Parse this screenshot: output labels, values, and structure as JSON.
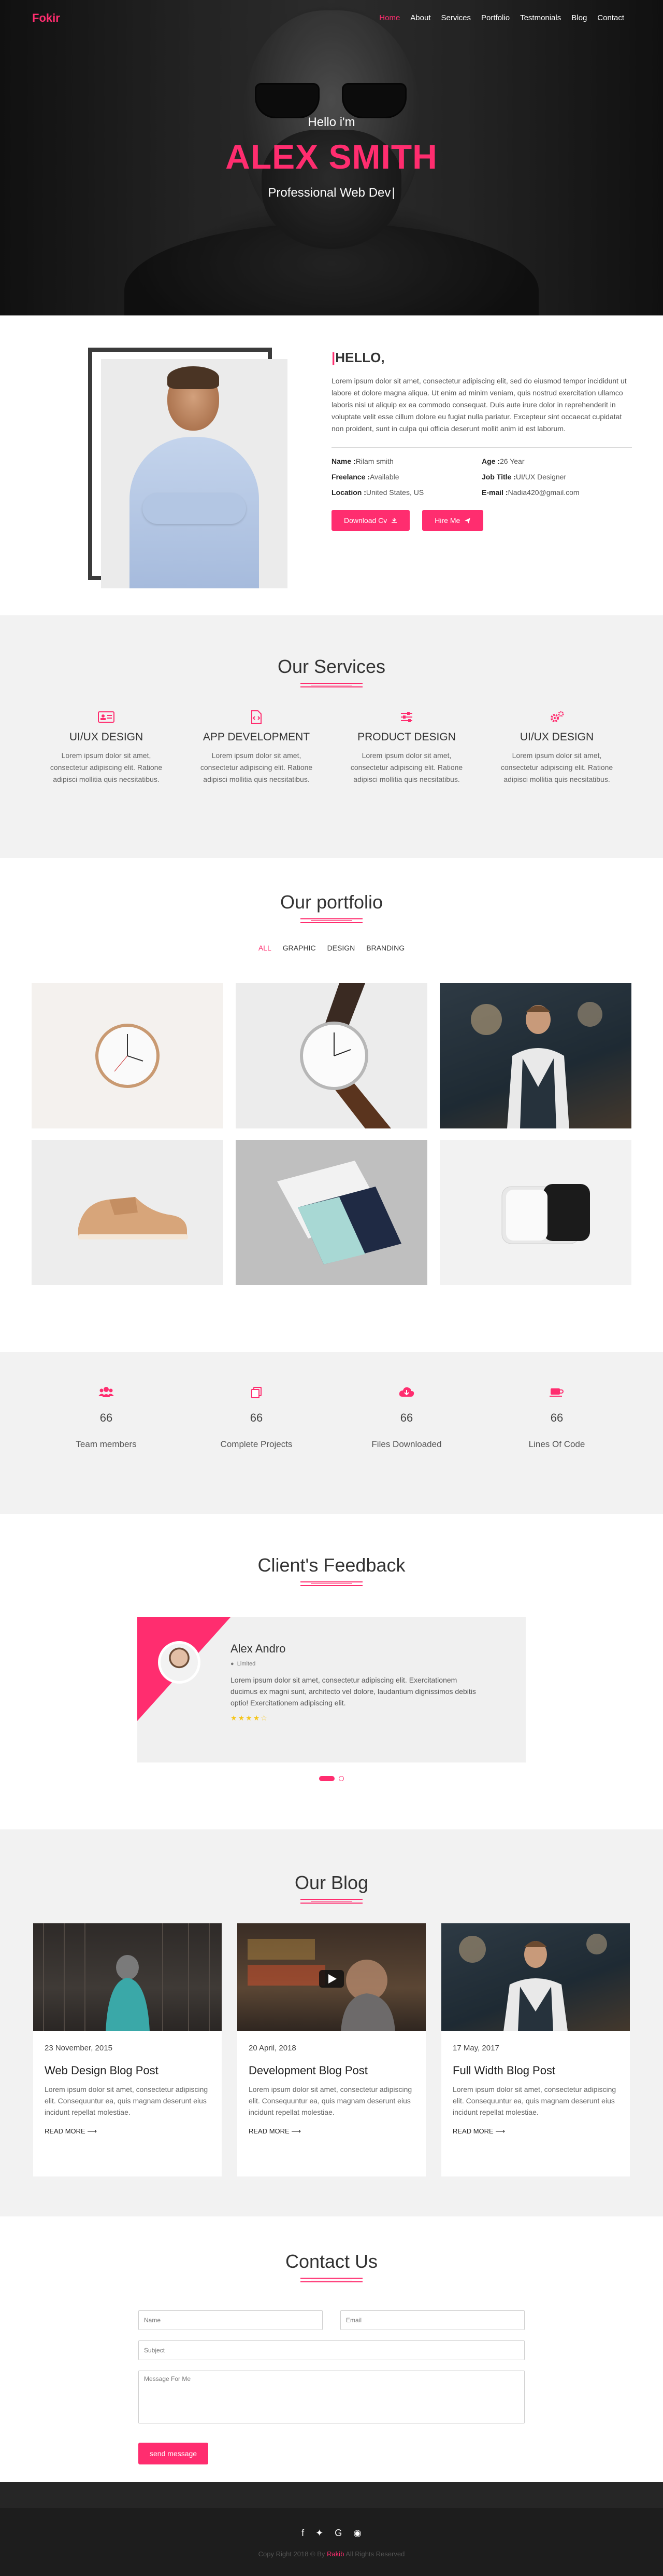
{
  "nav": {
    "brand": "Fokir",
    "items": [
      "Home",
      "About",
      "Services",
      "Portfolio",
      "Testmonials",
      "Blog",
      "Contact"
    ],
    "active": "Home"
  },
  "hero": {
    "hello": "Hello i'm",
    "name": "ALEX SMITH",
    "role": "Professional Web Dev"
  },
  "about": {
    "title_bar": "|",
    "title": "HELLO,",
    "text": "Lorem ipsum dolor sit amet, consectetur adipiscing elit, sed do eiusmod tempor incididunt ut labore et dolore magna aliqua. Ut enim ad minim veniam, quis nostrud exercitation ullamco laboris nisi ut aliquip ex ea commodo consequat. Duis aute irure dolor in reprehenderit in voluptate velit esse cillum dolore eu fugiat nulla pariatur. Excepteur sint occaecat cupidatat non proident, sunt in culpa qui officia deserunt mollit anim id est laborum.",
    "info": [
      {
        "label": "Name :",
        "value": "Rilam smith"
      },
      {
        "label": "Age :",
        "value": "26 Year"
      },
      {
        "label": "Freelance :",
        "value": "Available"
      },
      {
        "label": "Job Title :",
        "value": "UI/UX Designer"
      },
      {
        "label": "Location :",
        "value": "United States, US"
      },
      {
        "label": "E-mail :",
        "value": "Nadia420@gmail.com"
      }
    ],
    "btn_cv": "Download Cv",
    "btn_hire": "Hire Me"
  },
  "services": {
    "title": "Our Services",
    "items": [
      {
        "title": "UI/UX DESIGN",
        "text": "Lorem ipsum dolor sit amet, consectetur adipiscing elit. Ratione adipisci mollitia quis necsitatibus.",
        "icon": "id-card-icon"
      },
      {
        "title": "APP DEVELOPMENT",
        "text": "Lorem ipsum dolor sit amet, consectetur adipiscing elit. Ratione adipisci mollitia quis necsitatibus.",
        "icon": "file-code-icon"
      },
      {
        "title": "PRODUCT DESIGN",
        "text": "Lorem ipsum dolor sit amet, consectetur adipiscing elit. Ratione adipisci mollitia quis necsitatibus.",
        "icon": "sliders-icon"
      },
      {
        "title": "UI/UX DESIGN",
        "text": "Lorem ipsum dolor sit amet, consectetur adipiscing elit. Ratione adipisci mollitia quis necsitatibus.",
        "icon": "cogs-icon"
      }
    ]
  },
  "portfolio": {
    "title": "Our portfolio",
    "filters": [
      "ALL",
      "GRAPHIC",
      "DESIGN",
      "BRANDING"
    ],
    "active": "ALL",
    "items": [
      "wall-clock",
      "wrist-watch",
      "man-in-vest",
      "sneaker",
      "business-cards",
      "power-bank"
    ]
  },
  "counters": [
    {
      "num": "66",
      "label": "Team members",
      "icon": "users-icon"
    },
    {
      "num": "66",
      "label": "Complete Projects",
      "icon": "copy-icon"
    },
    {
      "num": "66",
      "label": "Files Downloaded",
      "icon": "cloud-download-icon"
    },
    {
      "num": "66",
      "label": "Lines Of Code",
      "icon": "coffee-icon"
    }
  ],
  "feedback": {
    "title": "Client's Feedback",
    "name": "Alex Andro",
    "location": "Limited",
    "text": "Lorem ipsum dolor sit amet, consectetur adipiscing elit. Exercitationem ducimus ex magni sunt, architecto vel dolore, laudantium dignissimos debitis optio! Exercitationem adipiscing elit.",
    "rating": 4
  },
  "blog": {
    "title": "Our Blog",
    "posts": [
      {
        "date": "23 November, 2015",
        "title": "Web Design Blog Post",
        "text": "Lorem ipsum dolor sit amet, consectetur adipiscing elit. Consequuntur ea, quis magnam deserunt eius incidunt repellat molestiae.",
        "more": "READ MORE"
      },
      {
        "date": "20 April, 2018",
        "title": "Development Blog Post",
        "text": "Lorem ipsum dolor sit amet, consectetur adipiscing elit. Consequuntur ea, quis magnam deserunt eius incidunt repellat molestiae.",
        "more": "READ MORE"
      },
      {
        "date": "17 May, 2017",
        "title": "Full Width Blog Post",
        "text": "Lorem ipsum dolor sit amet, consectetur adipiscing elit. Consequuntur ea, quis magnam deserunt eius incidunt repellat molestiae.",
        "more": "READ MORE"
      }
    ]
  },
  "contact": {
    "title": "Contact Us",
    "name_ph": "Name",
    "email_ph": "Email",
    "subject_ph": "Subject",
    "message_ph": "Message For Me",
    "send": "send message"
  },
  "footer": {
    "copy_prefix": "Copy Right 2018 © By",
    "copy_brand": "Rakib",
    "copy_suffix": "All Rights Reserved"
  },
  "colors": {
    "accent": "#ff2d6f",
    "dark": "#1d1d1d",
    "light_bg": "#f2f2f2"
  }
}
